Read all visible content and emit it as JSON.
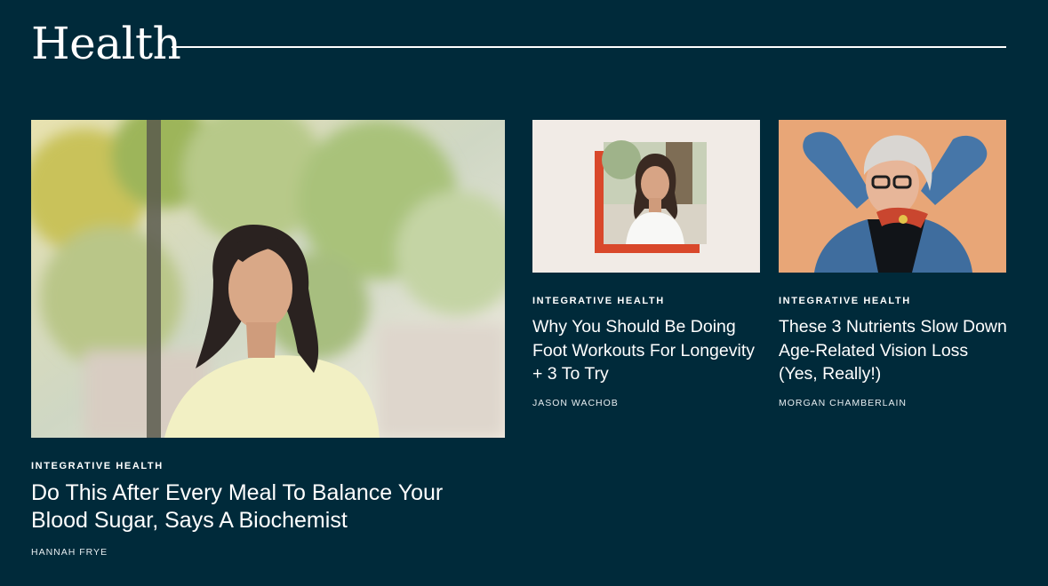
{
  "section": {
    "title": "Health"
  },
  "articles": [
    {
      "category": "INTEGRATIVE HEALTH",
      "headline": "Do This After Every Meal To Balance Your Blood Sugar, Says A Biochemist",
      "author": "HANNAH FRYE"
    },
    {
      "category": "INTEGRATIVE HEALTH",
      "headline": "Why You Should Be Doing Foot Workouts For Longevity + 3 To Try",
      "author": "JASON WACHOB"
    },
    {
      "category": "INTEGRATIVE HEALTH",
      "headline": "These 3 Nutrients Slow Down Age-Related Vision Loss (Yes, Really!)",
      "author": "MORGAN CHAMBERLAIN"
    }
  ],
  "colors": {
    "background": "#002a3a",
    "text": "#ffffff",
    "accent_orange": "#d9482b"
  }
}
